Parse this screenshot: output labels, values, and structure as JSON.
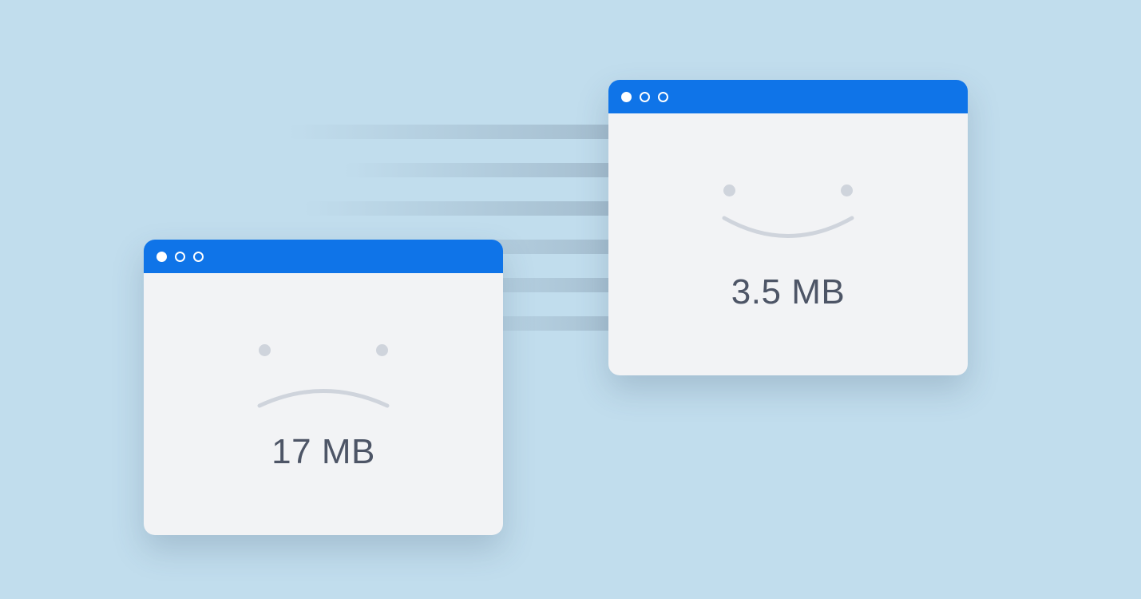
{
  "colors": {
    "background": "#c1dded",
    "titlebar": "#0f74e8",
    "window_bg": "#f2f3f5",
    "text": "#4d5566",
    "face_stroke": "#cfd4dc"
  },
  "windows": {
    "large": {
      "size_label": "17 MB",
      "mood": "sad"
    },
    "small": {
      "size_label": "3.5 MB",
      "mood": "happy"
    }
  }
}
